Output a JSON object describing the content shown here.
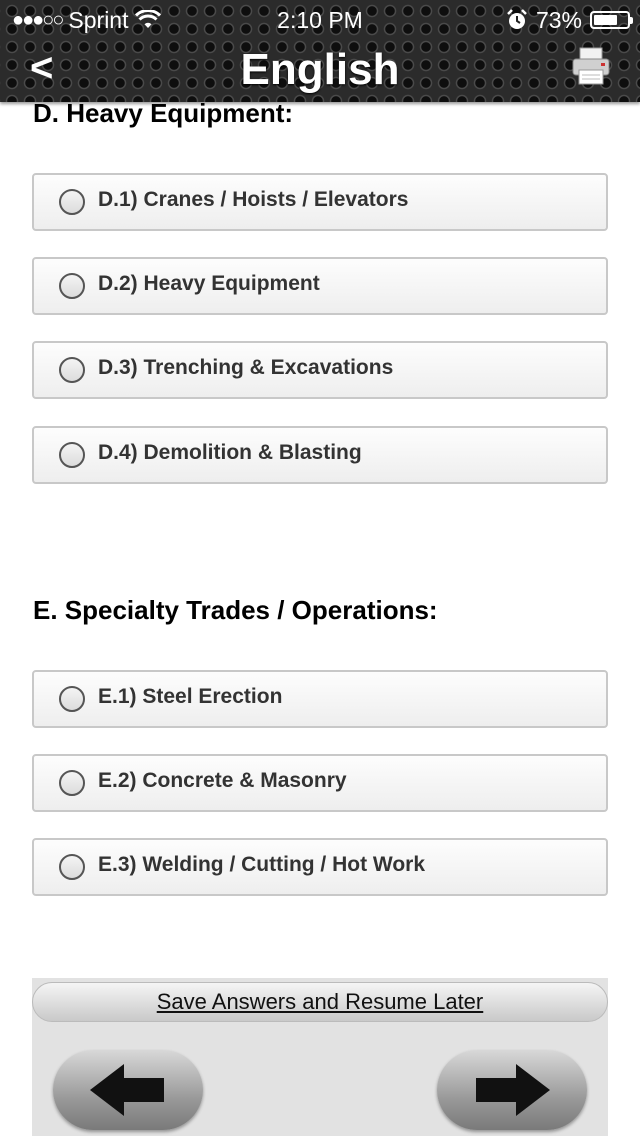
{
  "status_bar": {
    "signal_dots": "●●●○○",
    "carrier": "Sprint",
    "time": "2:10 PM",
    "battery_percent": "73%",
    "battery_level": 0.73
  },
  "header": {
    "back_label": "<",
    "title": "English",
    "print_icon": "printer-icon"
  },
  "sections": [
    {
      "heading": "D. Heavy Equipment:",
      "options": [
        "D.1) Cranes / Hoists / Elevators",
        "D.2) Heavy Equipment",
        "D.3) Trenching & Excavations",
        "D.4) Demolition & Blasting"
      ]
    },
    {
      "heading": "E. Specialty Trades / Operations:",
      "options": [
        "E.1) Steel Erection",
        "E.2) Concrete & Masonry",
        "E.3) Welding / Cutting / Hot Work"
      ]
    }
  ],
  "footer": {
    "save_label": "Save Answers and Resume Later",
    "prev_icon": "arrow-left-icon",
    "next_icon": "arrow-right-icon"
  }
}
